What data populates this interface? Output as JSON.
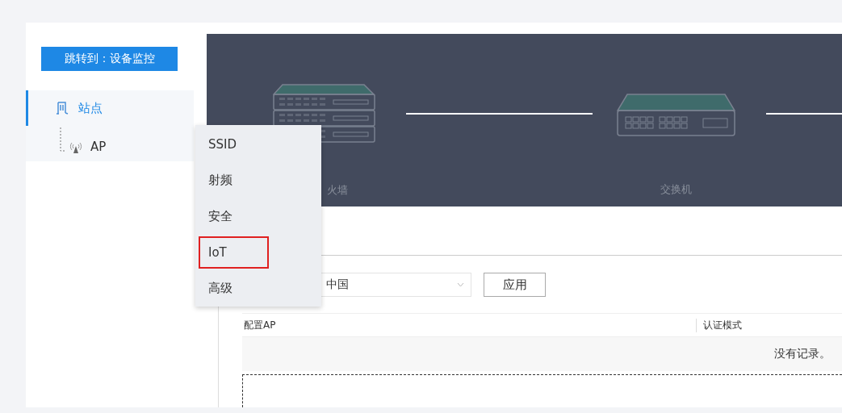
{
  "sidebar": {
    "jump_button": "跳转到：设备监控",
    "tree": [
      {
        "label": "站点",
        "selected": true,
        "children": [
          {
            "label": "AP",
            "selected": false
          }
        ]
      }
    ]
  },
  "topology": {
    "nodes": [
      {
        "kind": "firewall",
        "label": "火墙"
      },
      {
        "kind": "switch",
        "label": "交换机"
      }
    ]
  },
  "region": {
    "value": "中国"
  },
  "apply_button": "应用",
  "table": {
    "columns": [
      "配置AP",
      "认证模式"
    ],
    "empty_text": "没有记录。"
  },
  "context_menu": {
    "items": [
      {
        "label": "SSID",
        "highlighted": false
      },
      {
        "label": "射频",
        "highlighted": false
      },
      {
        "label": "安全",
        "highlighted": false
      },
      {
        "label": "IoT",
        "highlighted": true
      },
      {
        "label": "高级",
        "highlighted": false
      }
    ]
  }
}
